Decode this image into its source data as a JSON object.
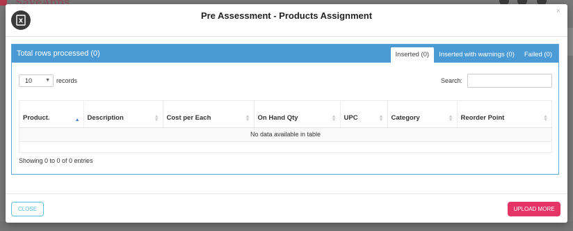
{
  "background": {
    "brand": "SaveApps"
  },
  "modal": {
    "title": "Pre Assessment - Products Assignment",
    "close_glyph": "×",
    "icon": "excel-icon"
  },
  "panel": {
    "title": "Total rows processed (0)",
    "tabs": [
      {
        "label": "Inserted (0)",
        "active": true
      },
      {
        "label": "Inserted with warnings (0)",
        "active": false
      },
      {
        "label": "Failed (0)",
        "active": false
      }
    ]
  },
  "table_controls": {
    "length_value": "10",
    "records_label": "records",
    "search_label": "Search:",
    "search_value": ""
  },
  "table": {
    "columns": [
      "Product.",
      "Description",
      "Cost per Each",
      "On Hand Qty",
      "UPC",
      "Category",
      "Reorder Point"
    ],
    "empty_message": "No data available in table",
    "info": "Showing 0 to 0 of 0 entries"
  },
  "footer": {
    "close_label": "CLOSE",
    "upload_label": "UPLOAD MORE"
  },
  "colors": {
    "panel_header": "#4a9ad5",
    "upload_button": "#e63466",
    "close_button": "#5bc0de"
  }
}
